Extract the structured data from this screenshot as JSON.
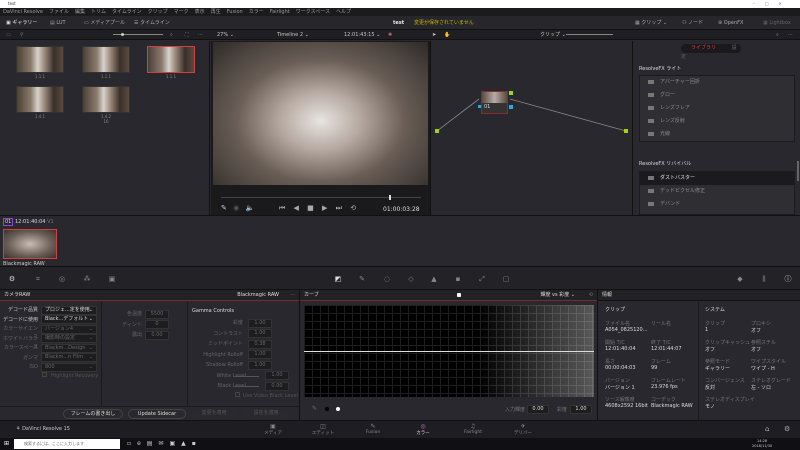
{
  "window": {
    "title": "test"
  },
  "menu": [
    "DaVinci Resolve",
    "ファイル",
    "編集",
    "トリム",
    "タイムライン",
    "クリップ",
    "マーク",
    "表示",
    "再生",
    "Fusion",
    "カラー",
    "Fairlight",
    "ワークスペース",
    "ヘルプ"
  ],
  "topbar": {
    "gallery": "ギャラリー",
    "lut": "LUT",
    "media_pool": "メディアプール",
    "timeline": "タイムライン",
    "project": "test",
    "unsaved": "変更が保存されていません",
    "clips": "クリップ",
    "nodes": "ノード",
    "openfx": "OpenFX",
    "lightbox": "Lightbox"
  },
  "viewer_bar": {
    "zoom": "27%",
    "timeline": "Timeline 2",
    "timecode": "12:01:43:15",
    "clip_mode": "クリップ"
  },
  "gallery": {
    "stills": [
      {
        "label": "1.1.1"
      },
      {
        "label": "1.1.1"
      },
      {
        "label": "1.1.1"
      },
      {
        "label": "1.4.1"
      },
      {
        "label": "1.4.2",
        "sub": "16"
      }
    ]
  },
  "viewer": {
    "timecode": "01:00:03:28"
  },
  "node": {
    "label": "01"
  },
  "library": {
    "tabs": [
      "ライブラリ",
      "設定"
    ],
    "sections": [
      {
        "title": "ResolveFX ライト",
        "items": [
          "アパーチャー回折",
          "グロー",
          "レンズフレア",
          "レンズ反射",
          "光線"
        ]
      },
      {
        "title": "ResolveFX リバイバル",
        "items": [
          "ダストバスター",
          "デッドピクセル修正",
          "デバンド"
        ]
      }
    ]
  },
  "timeline_clip": {
    "number": "01",
    "timecode": "12:01:40:04",
    "track": "V1",
    "name": "Blackmagic RAW"
  },
  "camera_raw": {
    "title": "カメラRAW",
    "format": "Blackmagic RAW",
    "fields": [
      {
        "label": "デコード品質",
        "value": "プロジェ...定を使用",
        "on": true
      },
      {
        "label": "デコードに使用",
        "value": "Black...デフォルト",
        "on": true
      },
      {
        "label": "カラーサイエンス",
        "value": "バージョン4"
      },
      {
        "label": "ホワイトバランス",
        "value": "撮影時の設定"
      },
      {
        "label": "カラースペース",
        "value": "Blackm...Design"
      },
      {
        "label": "ガンマ",
        "value": "Blackm...n Film"
      },
      {
        "label": "ISO",
        "value": "800"
      }
    ],
    "highlight_recovery": "Highlight Recovery",
    "mid": [
      {
        "label": "色温度",
        "value": "5500"
      },
      {
        "label": "ティント",
        "value": "0"
      },
      {
        "label": "露出",
        "value": "0.00"
      }
    ],
    "gamma_title": "Gamma Controls",
    "gamma": [
      {
        "label": "彩度",
        "value": "1.00"
      },
      {
        "label": "コントラスト",
        "value": "1.00"
      },
      {
        "label": "ミッドポイント",
        "value": "0.38"
      },
      {
        "label": "Highlight Rolloff",
        "value": "1.00"
      },
      {
        "label": "Shadow Rolloff",
        "value": "1.00"
      },
      {
        "label": "White Level",
        "value": "1.00"
      },
      {
        "label": "Black Level",
        "value": "0.00"
      }
    ],
    "use_video_black": "Use Video Black Level",
    "buttons": [
      "フレームの書き出し",
      "Update Sidecar",
      "変更を適用",
      "設定を適用"
    ]
  },
  "curves": {
    "title": "カーブ",
    "mode": "輝度 vs 彩度",
    "input_label": "入力輝度",
    "input_value": "0.00",
    "sat_label": "彩度",
    "sat_value": "1.00"
  },
  "info": {
    "title": "情報",
    "clip_title": "クリップ",
    "system_title": "システム",
    "clip": [
      {
        "k": "ファイル名",
        "v": "A054_0825120..."
      },
      {
        "k": "リール名",
        "v": ""
      },
      {
        "k": "開始 T/C",
        "v": "12:01:40:04"
      },
      {
        "k": "終了 T/C",
        "v": "12:01:44:07"
      },
      {
        "k": "長さ",
        "v": "00:00:04:03"
      },
      {
        "k": "フレーム",
        "v": "99"
      },
      {
        "k": "バージョン",
        "v": "バージョン 1"
      },
      {
        "k": "フレームレート",
        "v": "23.976 fps"
      },
      {
        "k": "ソース解像度",
        "v": "4608x2592 16bit"
      },
      {
        "k": "コーデック",
        "v": "Blackmagic RAW"
      }
    ],
    "system": [
      {
        "k": "クリップ",
        "v": "1"
      },
      {
        "k": "プロキシ",
        "v": "オフ"
      },
      {
        "k": "クリップキャッシュ",
        "v": "オフ"
      },
      {
        "k": "参照スチル",
        "v": "オフ"
      },
      {
        "k": "参照モード",
        "v": "ギャラリー"
      },
      {
        "k": "ワイプスタイル",
        "v": "ワイプ - H"
      },
      {
        "k": "コンバージェンス",
        "v": "反対"
      },
      {
        "k": "ステレオグレード",
        "v": "左 - ソロ"
      },
      {
        "k": "ステレオディスプレイ",
        "v": "モノ"
      }
    ]
  },
  "pages": {
    "app": "DaVinci Resolve 15",
    "items": [
      {
        "label": "メディア",
        "icon": "▣"
      },
      {
        "label": "エディット",
        "icon": "◫"
      },
      {
        "label": "Fusion",
        "icon": "✎"
      },
      {
        "label": "カラー",
        "icon": "◎"
      },
      {
        "label": "Fairlight",
        "icon": "♫"
      },
      {
        "label": "デリバー",
        "icon": "✈"
      }
    ]
  },
  "taskbar": {
    "search": "検索するには、ここに入力します",
    "time": "14:28",
    "date": "2018/11/30"
  },
  "colors": {
    "accent": "#c83a3a",
    "warning": "#c8b400",
    "node_link": "#a6d400"
  }
}
